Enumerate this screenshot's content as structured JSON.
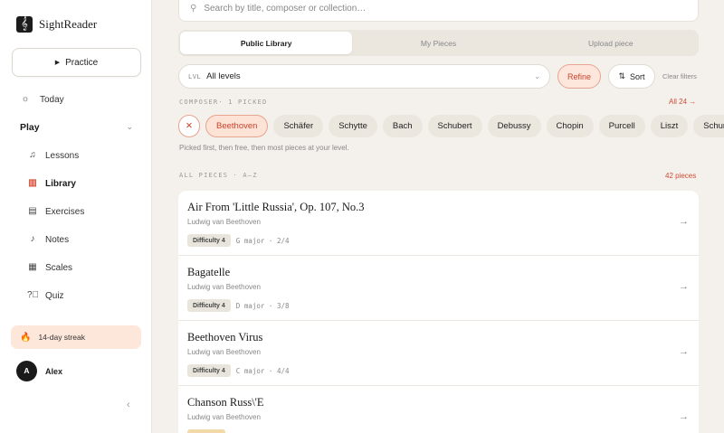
{
  "brand": {
    "name": "SightReader",
    "logo_glyph": "𝄞"
  },
  "sidebar": {
    "practice_label": "Practice",
    "today_label": "Today",
    "play_label": "Play",
    "items": [
      {
        "label": "Lessons",
        "icon": "lessons-icon",
        "active": false
      },
      {
        "label": "Library",
        "icon": "library-icon",
        "active": true
      },
      {
        "label": "Exercises",
        "icon": "exercises-icon",
        "active": false
      },
      {
        "label": "Notes",
        "icon": "notes-icon",
        "active": false
      },
      {
        "label": "Scales",
        "icon": "scales-icon",
        "active": false
      },
      {
        "label": "Quiz",
        "icon": "quiz-icon",
        "active": false
      }
    ],
    "streak_label": "14-day streak",
    "user": {
      "initial": "A",
      "name": "Alex"
    }
  },
  "search": {
    "placeholder": "Search by title, composer or collection…"
  },
  "tabs": [
    {
      "label": "Public Library",
      "active": true
    },
    {
      "label": "My Pieces",
      "active": false
    },
    {
      "label": "Upload piece",
      "active": false
    }
  ],
  "filters": {
    "level_prefix": "LVL",
    "level_value": "All levels",
    "refine_label": "Refine",
    "sort_label": "Sort",
    "clear_label": "Clear filters"
  },
  "composer_section": {
    "label": "COMPOSER· 1 PICKED",
    "all_link": "All 24 →",
    "chips": [
      "Beethoven",
      "Schäfer",
      "Schytte",
      "Bach",
      "Schubert",
      "Debussy",
      "Chopin",
      "Purcell",
      "Liszt",
      "Schumann"
    ],
    "selected": "Beethoven",
    "hint": "Picked first, then free, then most pieces at your level."
  },
  "pieces_section": {
    "label": "ALL PIECES · A–Z",
    "count": "42 pieces",
    "items": [
      {
        "title": "Air From 'Little Russia', Op. 107, No.3",
        "composer": "Ludwig van Beethoven",
        "difficulty": "Difficulty 4",
        "meta": "G major · 2/4"
      },
      {
        "title": "Bagatelle",
        "composer": "Ludwig van Beethoven",
        "difficulty": "Difficulty 4",
        "meta": "D major · 3/8"
      },
      {
        "title": "Beethoven Virus",
        "composer": "Ludwig van Beethoven",
        "difficulty": "Difficulty 4",
        "meta": "C major · 4/4"
      },
      {
        "title": "Chanson Russ\\'E",
        "composer": "Ludwig van Beethoven",
        "difficulty": "",
        "meta": ""
      }
    ]
  },
  "colors": {
    "accent": "#d6503a",
    "background": "#f4f1ec",
    "chip_selected_bg": "#fde3d5",
    "streak_bg": "#fde7da"
  }
}
